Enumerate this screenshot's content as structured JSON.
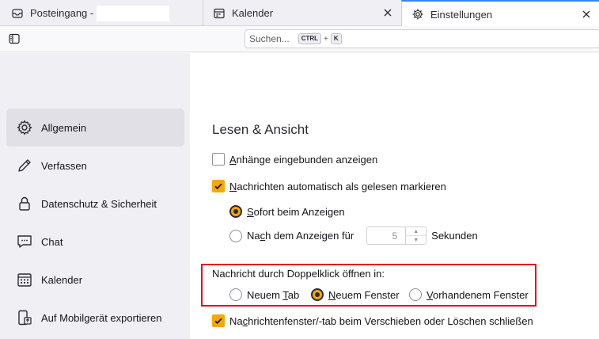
{
  "tabs": [
    {
      "label": "Posteingang - ",
      "icon": "inbox-icon"
    },
    {
      "label": "Kalender",
      "icon": "calendar-icon"
    },
    {
      "label": "Einstellungen",
      "icon": "gear-icon",
      "active": true
    }
  ],
  "toolbar": {
    "search_placeholder": "Suchen...",
    "shortcut_key1": "CTRL",
    "shortcut_plus": "+",
    "shortcut_key2": "K"
  },
  "sidebar": {
    "items": [
      {
        "label": "Allgemein",
        "icon": "gear-icon",
        "active": true
      },
      {
        "label": "Verfassen",
        "icon": "pencil-icon"
      },
      {
        "label": "Datenschutz & Sicherheit",
        "icon": "lock-icon"
      },
      {
        "label": "Chat",
        "icon": "chat-icon"
      },
      {
        "label": "Kalender",
        "icon": "calendar-icon"
      },
      {
        "label": "Auf Mobilgerät exportieren",
        "icon": "mobile-export-icon"
      }
    ]
  },
  "main": {
    "section_title": "Lesen & Ansicht",
    "show_attachments": {
      "pre": "",
      "ul": "A",
      "post": "nhänge eingebunden anzeigen",
      "checked": false
    },
    "auto_mark_read": {
      "pre": "",
      "ul": "N",
      "post": "achrichten automatisch als gelesen markieren",
      "checked": true
    },
    "immediately": {
      "pre": "",
      "ul": "S",
      "post": "ofort beim Anzeigen",
      "selected": true
    },
    "after_display": {
      "pre": "Na",
      "ul": "c",
      "post": "h dem Anzeigen für",
      "selected": false
    },
    "seconds_value": "5",
    "seconds_label": "Sekunden",
    "dblclick_label": "Nachricht durch Doppelklick öffnen in:",
    "open_new_tab": {
      "pre": "Neuem ",
      "ul": "T",
      "post": "ab",
      "selected": false
    },
    "open_new_window": {
      "pre": "",
      "ul": "N",
      "post": "euem Fenster",
      "selected": true
    },
    "open_existing_window": {
      "pre": "",
      "ul": "V",
      "post": "orhandenem Fenster",
      "selected": false
    },
    "close_on_move": {
      "pre": "Na",
      "ul": "c",
      "post": "hrichtenfenster/-tab beim Verschieben oder Löschen schließen",
      "checked": true
    }
  },
  "colors": {
    "accent": "#f6a800",
    "highlight_box": "#e00b1c",
    "tab_active_border": "#3a83f5"
  }
}
